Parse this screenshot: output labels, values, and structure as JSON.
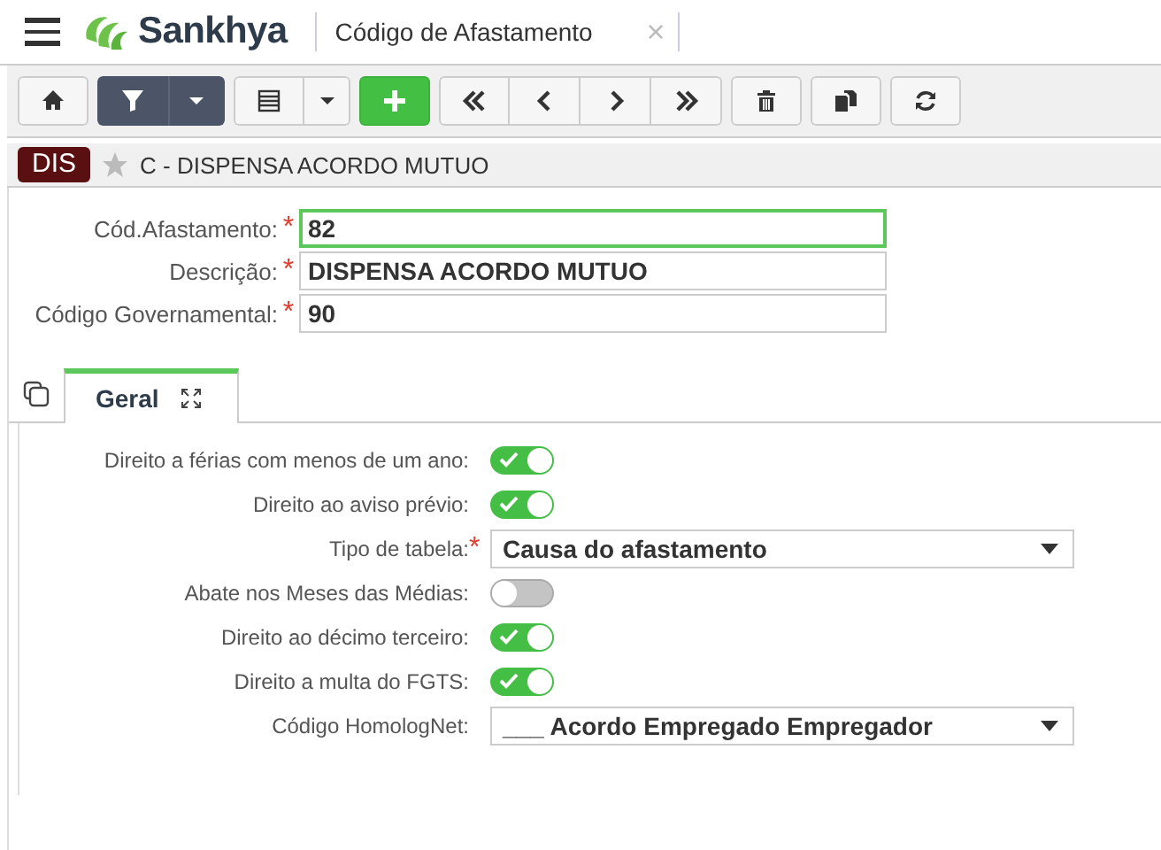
{
  "header": {
    "brand": "Sankhya",
    "title": "Código de Afastamento",
    "close": "×"
  },
  "toolbar": [
    {
      "buttons": [
        {
          "kind": "home"
        }
      ]
    },
    {
      "buttons": [
        {
          "kind": "filter"
        },
        {
          "kind": "caret"
        }
      ]
    },
    {
      "buttons": [
        {
          "kind": "grid"
        },
        {
          "kind": "caret"
        }
      ]
    },
    {
      "buttons": [
        {
          "kind": "plus"
        }
      ]
    },
    {
      "buttons": [
        {
          "kind": "first"
        },
        {
          "kind": "prev"
        },
        {
          "kind": "next"
        },
        {
          "kind": "last"
        }
      ]
    },
    {
      "buttons": [
        {
          "kind": "trash"
        }
      ]
    },
    {
      "buttons": [
        {
          "kind": "copy"
        }
      ]
    },
    {
      "buttons": [
        {
          "kind": "refresh"
        }
      ]
    }
  ],
  "record": {
    "badge": "DIS",
    "favorite": false,
    "title": "C - DISPENSA ACORDO MUTUO"
  },
  "fields": [
    {
      "label": "Cód.Afastamento:",
      "required_mark": "*",
      "value": "82",
      "focused": true
    },
    {
      "label": "Descrição:",
      "required_mark": "*",
      "value": "DISPENSA ACORDO MUTUO",
      "focused": false
    },
    {
      "label": "Código Governamental:",
      "required_mark": "*",
      "value": "90",
      "focused": false
    }
  ],
  "tabs": [
    {
      "label": "Geral",
      "selected": true
    }
  ],
  "options": [
    {
      "kind": "toggle",
      "label": "Direito a férias com menos de um ano:",
      "on": true
    },
    {
      "kind": "toggle",
      "label": "Direito ao aviso prévio:",
      "on": true
    },
    {
      "kind": "select",
      "label": "Tipo de tabela:",
      "required_mark": "*",
      "value": "Causa do afastamento"
    },
    {
      "kind": "toggle",
      "label": "Abate nos Meses das Médias:",
      "on": false
    },
    {
      "kind": "toggle",
      "label": "Direito ao décimo terceiro:",
      "on": true
    },
    {
      "kind": "toggle",
      "label": "Direito a multa do FGTS:",
      "on": true
    },
    {
      "kind": "select",
      "label": "Código HomologNet:",
      "value": "___ Acordo Empregado Empregador"
    }
  ]
}
